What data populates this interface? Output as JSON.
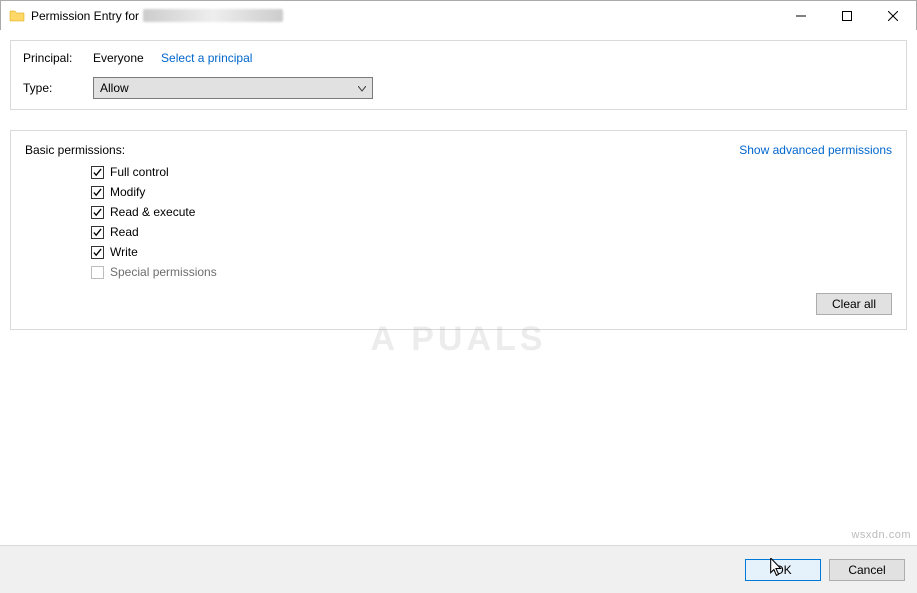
{
  "titlebar": {
    "title_prefix": "Permission Entry for"
  },
  "top_panel": {
    "principal_label": "Principal:",
    "principal_value": "Everyone",
    "select_principal_link": "Select a principal",
    "type_label": "Type:",
    "type_value": "Allow"
  },
  "perm_panel": {
    "header": "Basic permissions:",
    "advanced_link": "Show advanced permissions",
    "items": [
      {
        "label": "Full control",
        "checked": true,
        "enabled": true
      },
      {
        "label": "Modify",
        "checked": true,
        "enabled": true
      },
      {
        "label": "Read & execute",
        "checked": true,
        "enabled": true
      },
      {
        "label": "Read",
        "checked": true,
        "enabled": true
      },
      {
        "label": "Write",
        "checked": true,
        "enabled": true
      },
      {
        "label": "Special permissions",
        "checked": false,
        "enabled": false
      }
    ],
    "clear_all": "Clear all"
  },
  "footer": {
    "ok": "OK",
    "cancel": "Cancel"
  },
  "watermark": {
    "center": "A   PUALS",
    "corner": "wsxdn.com"
  }
}
